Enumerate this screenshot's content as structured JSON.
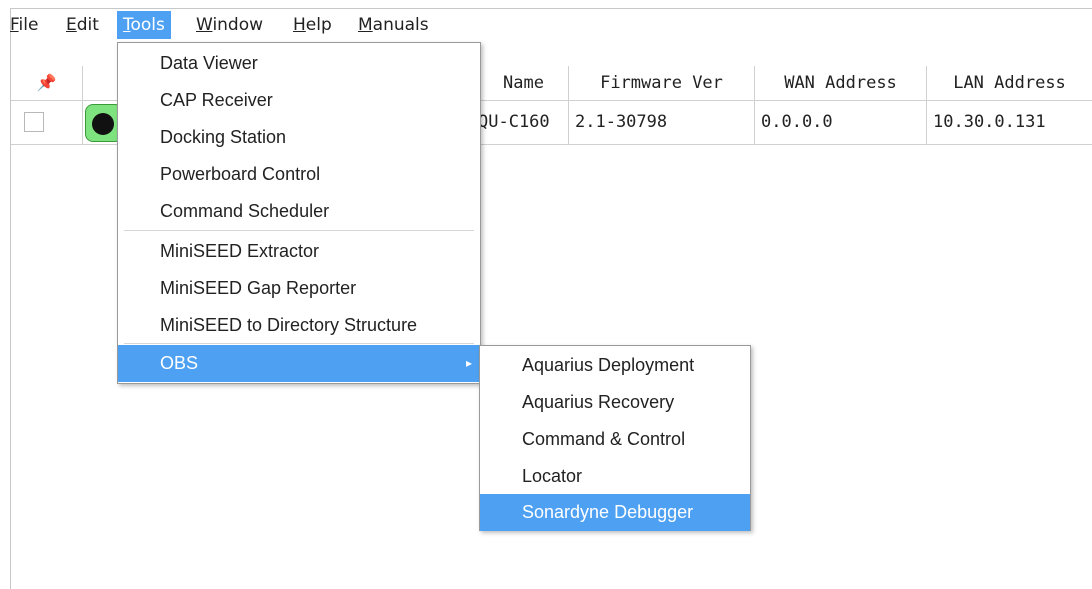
{
  "menubar": {
    "items": [
      {
        "label": "File",
        "ul": "F",
        "rest": "ile"
      },
      {
        "label": "Edit",
        "ul": "E",
        "rest": "dit"
      },
      {
        "label": "Tools",
        "ul": "T",
        "rest": "ools"
      },
      {
        "label": "Window",
        "ul": "W",
        "rest": "indow"
      },
      {
        "label": "Help",
        "ul": "H",
        "rest": "elp"
      },
      {
        "label": "Manuals",
        "ul": "M",
        "rest": "anuals"
      }
    ]
  },
  "table": {
    "headers": {
      "pin": "📌",
      "name": "Name",
      "firmware": "Firmware Ver",
      "wan": "WAN Address",
      "lan": "LAN Address"
    },
    "row": {
      "name": "QU-C160",
      "firmware": "2.1-30798",
      "wan": "0.0.0.0",
      "lan": "10.30.0.131",
      "status_color": "#7ee37e"
    }
  },
  "tools_menu": {
    "items": [
      "Data Viewer",
      "CAP Receiver",
      "Docking Station",
      "Powerboard Control",
      "Command Scheduler",
      "MiniSEED Extractor",
      "MiniSEED Gap Reporter",
      "MiniSEED to Directory Structure",
      "OBS"
    ],
    "submenu_arrow": "▸"
  },
  "obs_menu": {
    "items": [
      "Aquarius Deployment",
      "Aquarius Recovery",
      "Command & Control",
      "Locator",
      "Sonardyne Debugger"
    ]
  },
  "colors": {
    "selection": "#4ea1f2"
  }
}
